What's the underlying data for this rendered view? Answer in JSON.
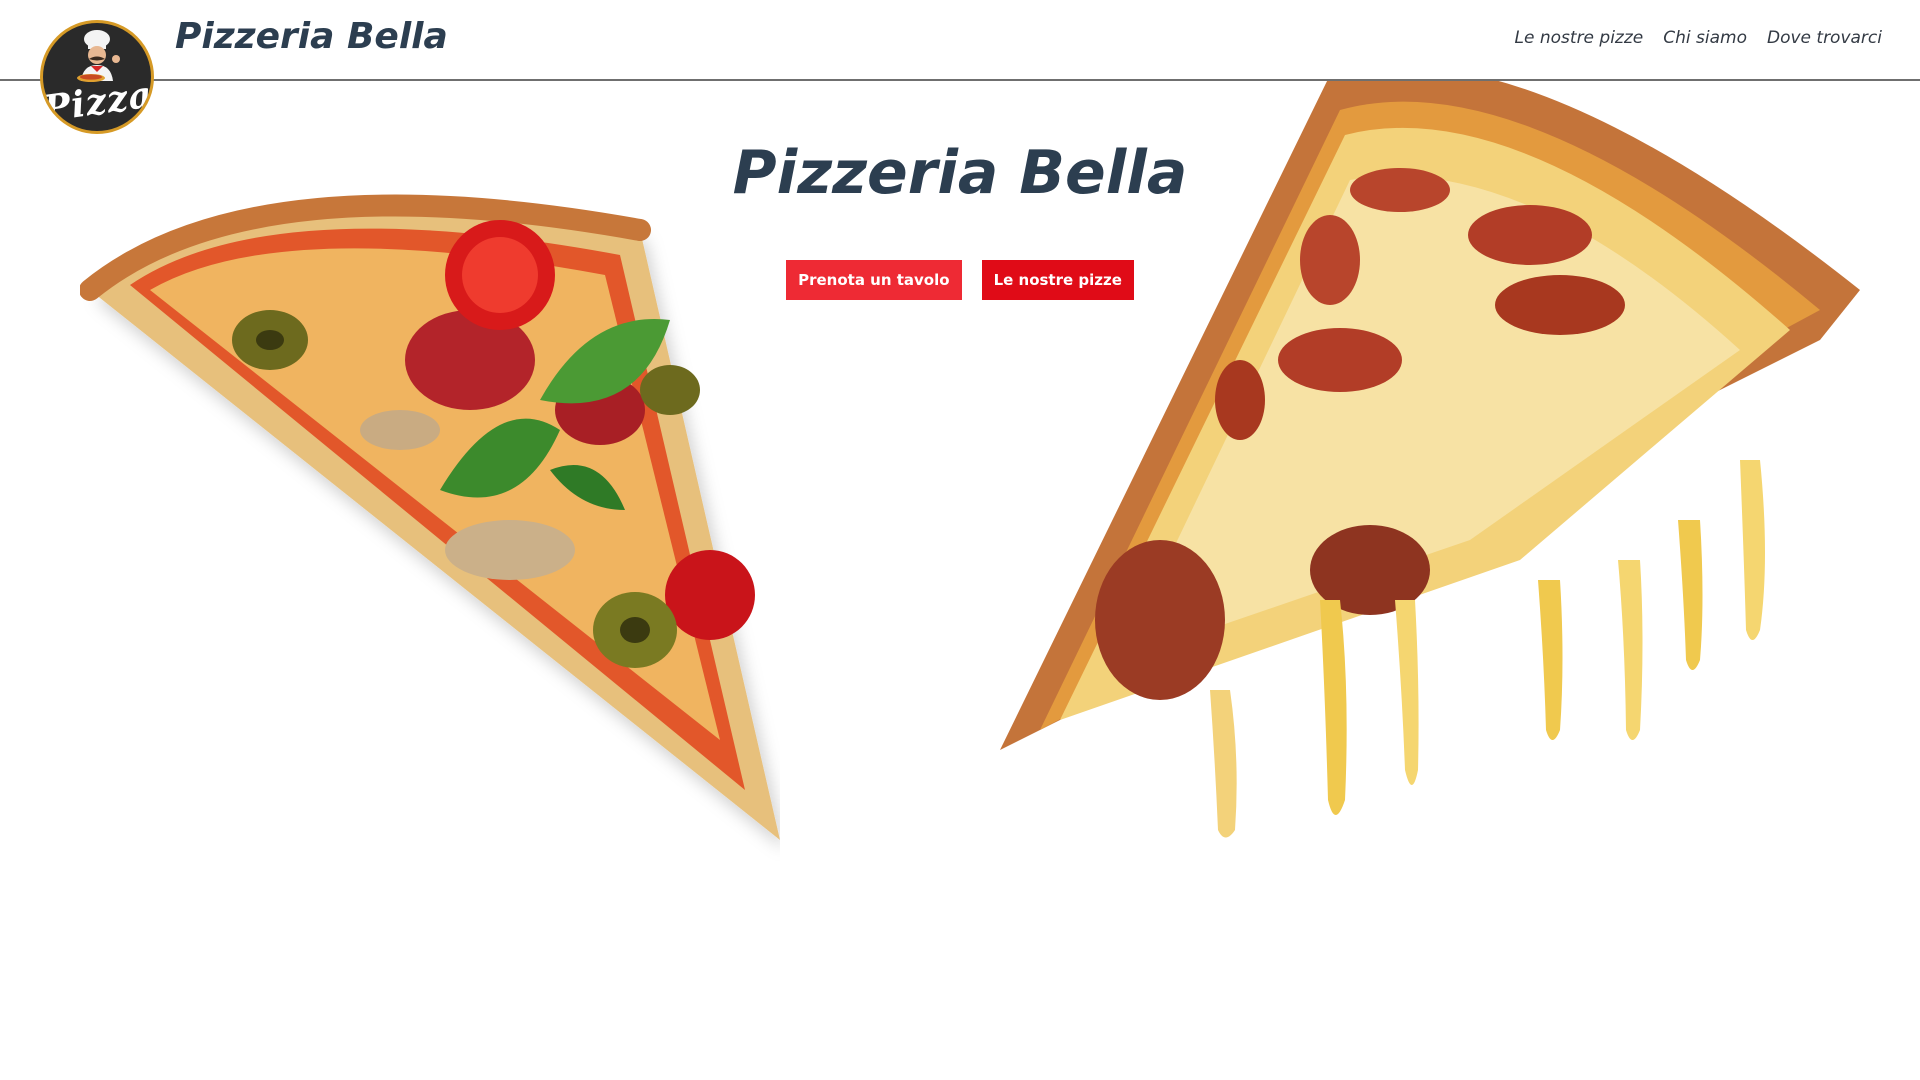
{
  "header": {
    "logo_text": "Pizza",
    "brand": "Pizzeria Bella",
    "nav": [
      "Le nostre pizze",
      "Chi siamo",
      "Dove trovarci"
    ]
  },
  "hero": {
    "title": "Pizzeria Bella",
    "buttons": {
      "book": "Prenota un tavolo",
      "menu": "Le nostre pizze"
    }
  },
  "images": {
    "left": "pizza-slice-vegetable",
    "right": "pizza-slice-pepperoni-cheese"
  },
  "colors": {
    "title": "#2c3e50",
    "button_primary": "#ee2a34",
    "button_secondary": "#e00b17",
    "logo_ring": "#d69a26"
  }
}
